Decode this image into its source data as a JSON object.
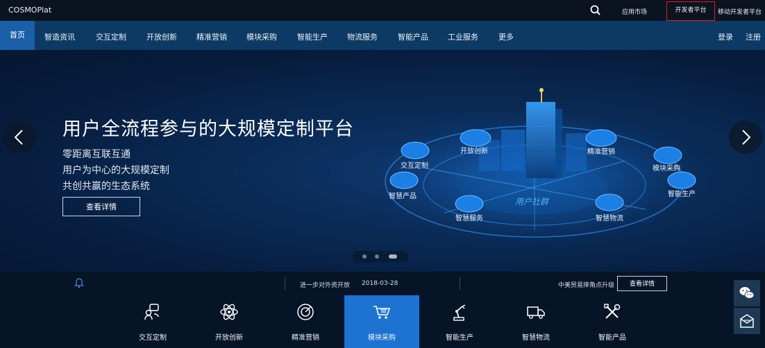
{
  "brand": "COSMOPlat",
  "topbar": {
    "app_market": "应用市场",
    "developer_platform": "开发者平台",
    "mobile_developer_platform": "移动开发者平台"
  },
  "nav": {
    "home": "首页",
    "items": [
      "智造资讯",
      "交互定制",
      "开放创新",
      "精准营销",
      "模块采购",
      "智能生产",
      "物流服务",
      "智能产品",
      "工业服务",
      "更多"
    ],
    "login": "登录",
    "register": "注册"
  },
  "hero": {
    "title": "用户全流程参与的大规模定制平台",
    "lines": [
      "零距离互联互通",
      "用户为中心的大规模定制",
      "共创共赢的生态系统"
    ],
    "cta": "查看详情",
    "scene_labels": [
      "交互定制",
      "开放创新",
      "精准营销",
      "模块采购",
      "智能生产",
      "智慧物流",
      "智慧服务",
      "智慧产品"
    ],
    "center_label": "用户社群"
  },
  "news": {
    "item1_title": "进一步对外资开放",
    "item1_date": "2018-03-28",
    "item2_title": "中美贸易摔角点升级",
    "cta": "查看详情"
  },
  "modules": [
    {
      "label": "交互定制",
      "icon": "interaction-icon"
    },
    {
      "label": "开放创新",
      "icon": "atom-icon"
    },
    {
      "label": "精准营销",
      "icon": "target-icon"
    },
    {
      "label": "模块采购",
      "icon": "cart-icon"
    },
    {
      "label": "智能生产",
      "icon": "robot-arm-icon"
    },
    {
      "label": "智慧物流",
      "icon": "truck-icon"
    },
    {
      "label": "智能产品",
      "icon": "tools-icon"
    }
  ],
  "active_module": "模块采购",
  "colors": {
    "nav_bg": "#0d3a64",
    "home_active": "#1a5fa8",
    "module_active": "#1e73d0",
    "highlight_border": "#e02020"
  }
}
